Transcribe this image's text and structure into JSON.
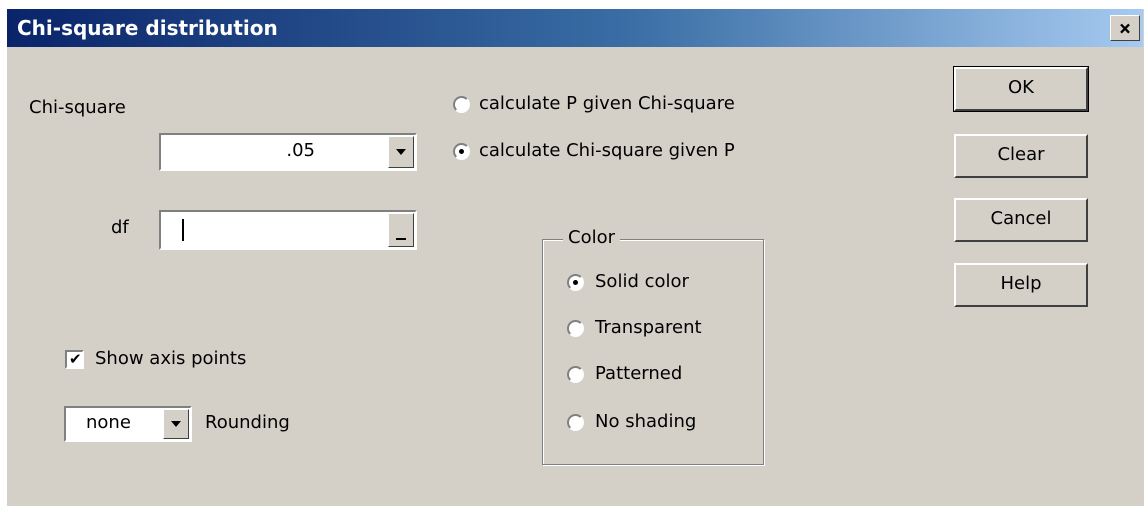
{
  "window": {
    "title": "Chi-square distribution",
    "close_glyph": "×"
  },
  "chi_square": {
    "label": "Chi-square",
    "value": ".05"
  },
  "df": {
    "label": "df",
    "value": ""
  },
  "mode_options": [
    {
      "label": "calculate P given Chi-square",
      "selected": false
    },
    {
      "label": "calculate Chi-square given P",
      "selected": true
    }
  ],
  "buttons": {
    "ok": "OK",
    "clear": "Clear",
    "cancel": "Cancel",
    "help": "Help"
  },
  "color_group": {
    "title": "Color",
    "options": [
      {
        "label": "Solid color",
        "selected": true
      },
      {
        "label": "Transparent",
        "selected": false
      },
      {
        "label": "Patterned",
        "selected": false
      },
      {
        "label": "No shading",
        "selected": false
      }
    ]
  },
  "show_axis_points": {
    "label": "Show axis points",
    "checked": true,
    "check_glyph": "✔"
  },
  "rounding": {
    "label": "Rounding",
    "value": "none"
  },
  "icons": {
    "dropdown": "chevron-down-icon",
    "check": "check-icon",
    "close": "close-icon"
  }
}
